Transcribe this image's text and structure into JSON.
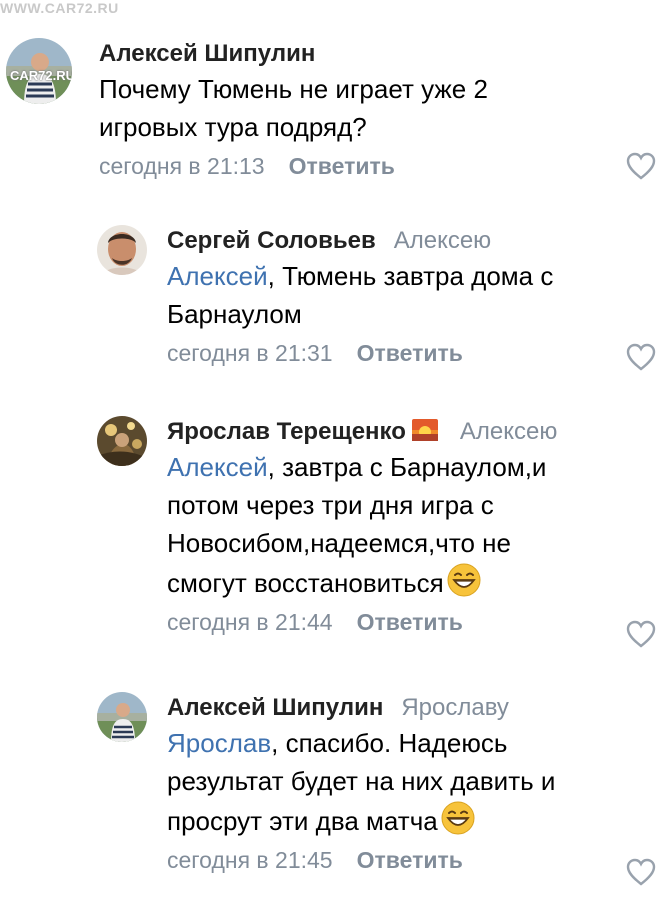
{
  "watermark": {
    "top": "WWW.CAR72.RU",
    "avatar": "CAR72.RU"
  },
  "comments": [
    {
      "author": "Алексей Шипулин",
      "reply_to": "",
      "mention": "",
      "text_line1": "Почему Тюмень не играет уже 2",
      "text_line2": "игровых тура подряд?",
      "time": "сегодня в 21:13",
      "reply_label": "Ответить",
      "avatar_icon": "avatar-photo",
      "like_icon": "heart-outline-icon"
    },
    {
      "author": "Сергей Соловьев",
      "reply_to": "Алексею",
      "mention": "Алексей",
      "text_line1": ", Тюмень завтра дома с",
      "text_line2": "Барнаулом",
      "time": "сегодня в 21:31",
      "reply_label": "Ответить",
      "avatar_icon": "avatar-photo",
      "like_icon": "heart-outline-icon"
    },
    {
      "author": "Ярослав Терещенко",
      "reply_to": "Алексею",
      "mention": "Алексей",
      "text_line1": ", завтра с Барнаулом,и",
      "text_line2": "потом через три дня игра с",
      "text_line3": "Новосибом,надеемся,что не",
      "text_line4": "смогут восстановиться",
      "time": "сегодня в 21:44",
      "reply_label": "Ответить",
      "avatar_icon": "avatar-photo",
      "name_emoji": "sunset-emoji",
      "text_emoji": "grinning-face-emoji",
      "like_icon": "heart-outline-icon"
    },
    {
      "author": "Алексей Шипулин",
      "reply_to": "Ярославу",
      "mention": "Ярослав",
      "text_line1": ", спасибо. Надеюсь",
      "text_line2": "результат будет на них давить и",
      "text_line3": "просрут эти два матча",
      "time": "сегодня в 21:45",
      "reply_label": "Ответить",
      "avatar_icon": "avatar-photo",
      "text_emoji": "grinning-face-emoji",
      "like_icon": "heart-outline-icon"
    }
  ],
  "colors": {
    "text": "#000000",
    "name": "#222222",
    "secondary": "#818c99",
    "mention": "#3f72b0",
    "emoji_yellow": "#f7c33b"
  }
}
